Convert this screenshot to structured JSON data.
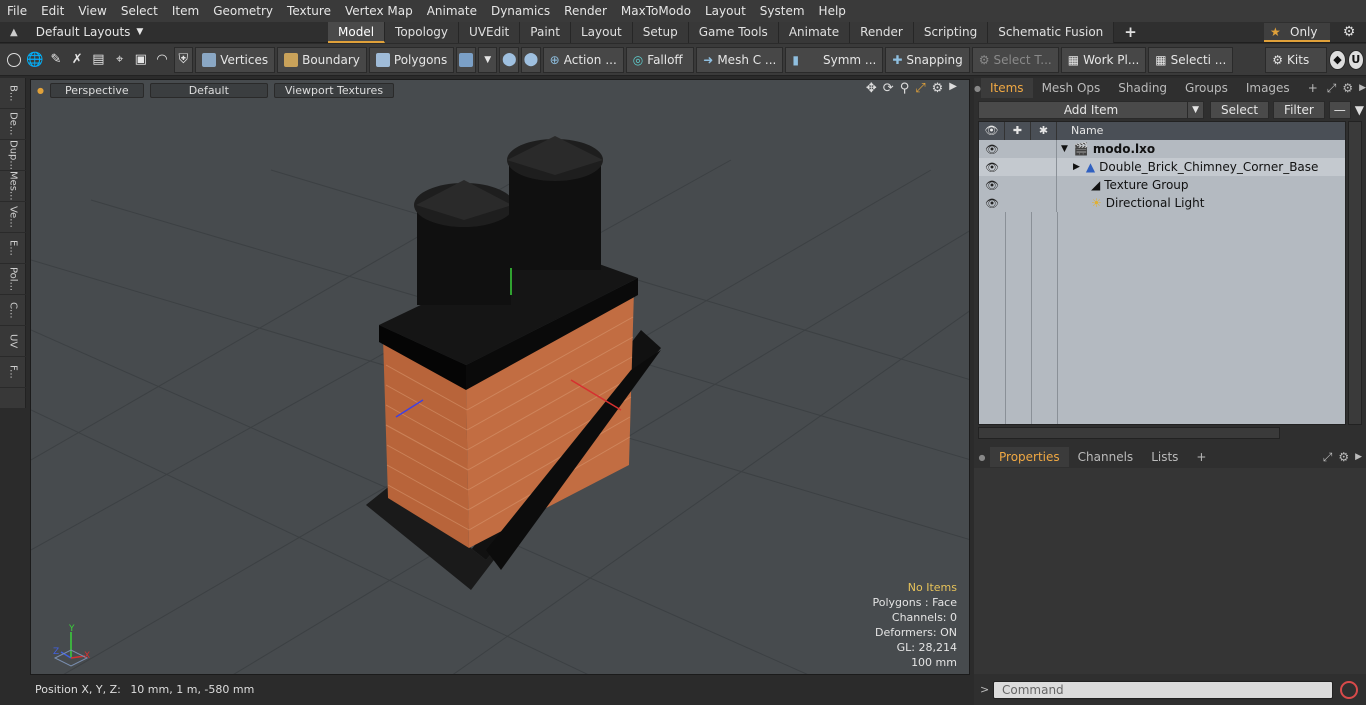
{
  "menu": [
    "File",
    "Edit",
    "View",
    "Select",
    "Item",
    "Geometry",
    "Texture",
    "Vertex Map",
    "Animate",
    "Dynamics",
    "Render",
    "MaxToModo",
    "Layout",
    "System",
    "Help"
  ],
  "layout_selector": "Default Layouts",
  "layout_tabs": [
    "Model",
    "Topology",
    "UVEdit",
    "Paint",
    "Layout",
    "Setup",
    "Game Tools",
    "Animate",
    "Render",
    "Scripting",
    "Schematic Fusion"
  ],
  "only_label": "Only",
  "toolbar": {
    "vertices": "Vertices",
    "boundary": "Boundary",
    "polygons": "Polygons",
    "action": "Action",
    "falloff": "Falloff",
    "mesh": "Mesh C ...",
    "symmetry": "Symm ...",
    "snapping": "Snapping",
    "select_t": "Select T...",
    "workplane": "Work Pl...",
    "selection": "Selecti ...",
    "kits": "Kits"
  },
  "left_strip": [
    "B...",
    "De...",
    "Dup...",
    "Mes...",
    "Ve...",
    "E...",
    "Pol...",
    "C...",
    "UV",
    "F..."
  ],
  "viewport": {
    "view_mode": "Perspective",
    "shading": "Default",
    "textures": "Viewport Textures",
    "stats": {
      "items": "No Items",
      "polygons": "Polygons : Face",
      "channels": "Channels: 0",
      "deformers": "Deformers: ON",
      "gl": "GL: 28,214",
      "scale": "100 mm"
    },
    "axis_labels": {
      "x": "X",
      "y": "Y",
      "z": "Z"
    }
  },
  "status": {
    "position_label": "Position X, Y, Z:",
    "position_value": "10 mm, 1 m, -580 mm"
  },
  "items_panel": {
    "tabs": [
      "Items",
      "Mesh Ops",
      "Shading",
      "Groups",
      "Images"
    ],
    "add_item": "Add Item",
    "select": "Select",
    "filter": "Filter",
    "name_col": "Name",
    "tree": [
      {
        "label": "modo.lxo",
        "icon": "scene-icon",
        "bold": true
      },
      {
        "label": "Double_Brick_Chimney_Corner_Base",
        "icon": "mesh-icon",
        "bold": false
      },
      {
        "label": "Texture Group",
        "icon": "texture-group-icon",
        "bold": false
      },
      {
        "label": "Directional Light",
        "icon": "light-icon",
        "bold": false
      }
    ]
  },
  "properties_panel": {
    "tabs": [
      "Properties",
      "Channels",
      "Lists"
    ]
  },
  "command_placeholder": "Command",
  "colors": {
    "accent": "#e0a13a",
    "viewport_bg": "#474b4e",
    "brick": "#b8643a",
    "tree_bg": "#b4bac1"
  }
}
